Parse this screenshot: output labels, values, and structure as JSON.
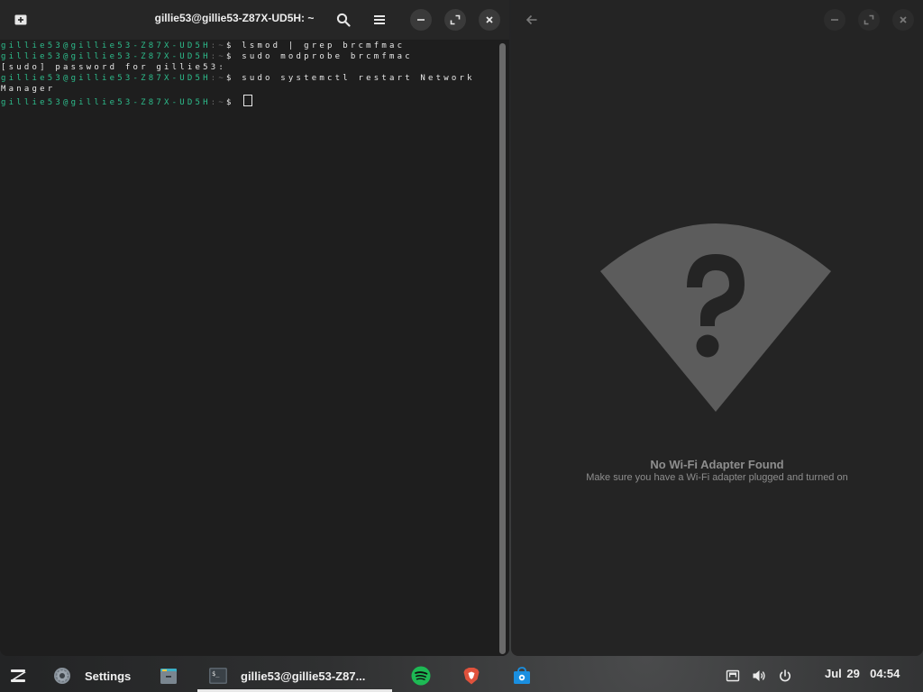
{
  "terminal": {
    "title": "gillie53@gillie53-Z87X-UD5H: ~",
    "lines": [
      {
        "user": "gillie53@gillie53-Z87X-UD5H",
        "path": ":~",
        "dollar": "$ ",
        "cmd": "lsmod | grep brcmfmac"
      },
      {
        "user": "gillie53@gillie53-Z87X-UD5H",
        "path": ":~",
        "dollar": "$ ",
        "cmd": "sudo modprobe brcmfmac"
      },
      {
        "text": "[sudo] password for gillie53:"
      },
      {
        "user": "gillie53@gillie53-Z87X-UD5H",
        "path": ":~",
        "dollar": "$ ",
        "cmd": "sudo systemctl restart Network"
      },
      {
        "text": "Manager"
      },
      {
        "user": "gillie53@gillie53-Z87X-UD5H",
        "path": ":~",
        "dollar": "$ ",
        "cmd": ""
      }
    ]
  },
  "settings": {
    "empty_title": "No Wi-Fi Adapter Found",
    "empty_subtitle": "Make sure you have a Wi-Fi adapter plugged and turned on"
  },
  "taskbar": {
    "settings_label": "Settings",
    "terminal_label": "gillie53@gillie53-Z87...",
    "date": "Jul 29",
    "time": "04:54"
  },
  "colors": {
    "prompt_green": "#2dbd8c",
    "spotify_green": "#1db954",
    "brave_orange": "#e0523c",
    "store_blue": "#1a8fe0"
  },
  "icons": [
    "new-tab-icon",
    "search-icon",
    "menu-icon",
    "minimize-icon",
    "maximize-icon",
    "close-icon",
    "back-icon",
    "wifi-question-icon",
    "zorin-menu-icon",
    "settings-gear-icon",
    "files-icon",
    "terminal-icon",
    "spotify-icon",
    "brave-icon",
    "software-store-icon",
    "network-wired-icon",
    "volume-icon",
    "power-icon"
  ]
}
